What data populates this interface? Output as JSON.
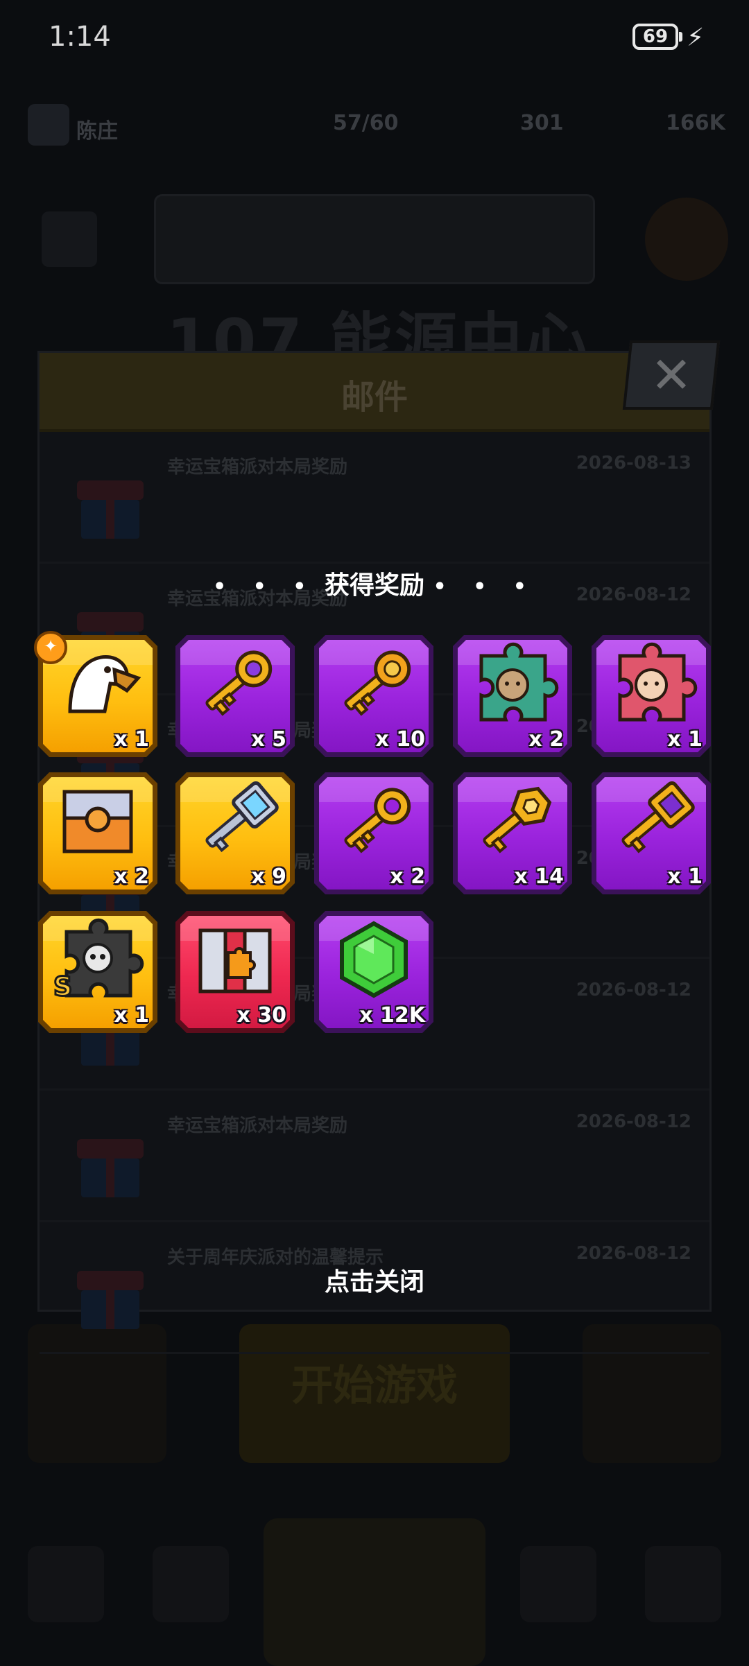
{
  "status_bar": {
    "time": "1:14",
    "battery": "69"
  },
  "background": {
    "player_name": "陈庄",
    "stat_energy": "57/60",
    "stat_gems": "301",
    "stat_gold": "166K",
    "level_title": "107 能源中心",
    "play_button": "开始游戏"
  },
  "mail": {
    "title": "邮件",
    "rows": [
      {
        "subject": "幸运宝箱派对本局奖励",
        "date": "2026-08-13"
      },
      {
        "subject": "幸运宝箱派对本局奖励",
        "date": "2026-08-12"
      },
      {
        "subject": "幸运宝箱派对本局奖励",
        "date": "2026-08-12"
      },
      {
        "subject": "幸运宝箱派对本局奖励",
        "date": "2026-08-12"
      },
      {
        "subject": "幸运宝箱派对本局奖励",
        "date": "2026-08-12"
      },
      {
        "subject": "幸运宝箱派对本局奖励",
        "date": "2026-08-12"
      },
      {
        "subject": "关于周年庆派对的温馨提示",
        "date": "2026-08-12"
      }
    ]
  },
  "rewards": {
    "title": "获得奖励",
    "dots": "• • •",
    "items": [
      {
        "icon": "eagle-pet-icon",
        "tier": "gold",
        "count": "x 1",
        "badge": true
      },
      {
        "icon": "amethyst-key-icon",
        "tier": "purple",
        "count": "x 5"
      },
      {
        "icon": "gold-key-icon",
        "tier": "purple",
        "count": "x 10"
      },
      {
        "icon": "soldier-puzzle-icon",
        "tier": "purple",
        "count": "x 2"
      },
      {
        "icon": "ninja-puzzle-icon",
        "tier": "purple",
        "count": "x 1"
      },
      {
        "icon": "silver-chest-icon",
        "tier": "gold",
        "count": "x 2"
      },
      {
        "icon": "silver-key-icon",
        "tier": "gold",
        "count": "x 9"
      },
      {
        "icon": "gold-key-plain-icon",
        "tier": "purple",
        "count": "x 2"
      },
      {
        "icon": "hex-key-icon",
        "tier": "purple",
        "count": "x 14"
      },
      {
        "icon": "purple-gem-key-icon",
        "tier": "purple",
        "count": "x 1"
      },
      {
        "icon": "skull-puzzle-s-icon",
        "tier": "gold",
        "count": "x 1"
      },
      {
        "icon": "puzzle-chest-icon",
        "tier": "red",
        "count": "x 30"
      },
      {
        "icon": "green-gem-icon",
        "tier": "purple",
        "count": "x 12K"
      }
    ]
  },
  "tap_to_close": "点击关闭",
  "colors": {
    "purple": "#9a23dc",
    "gold": "#ffbe10",
    "red": "#ee2850",
    "backdrop": "#0b0d10"
  }
}
